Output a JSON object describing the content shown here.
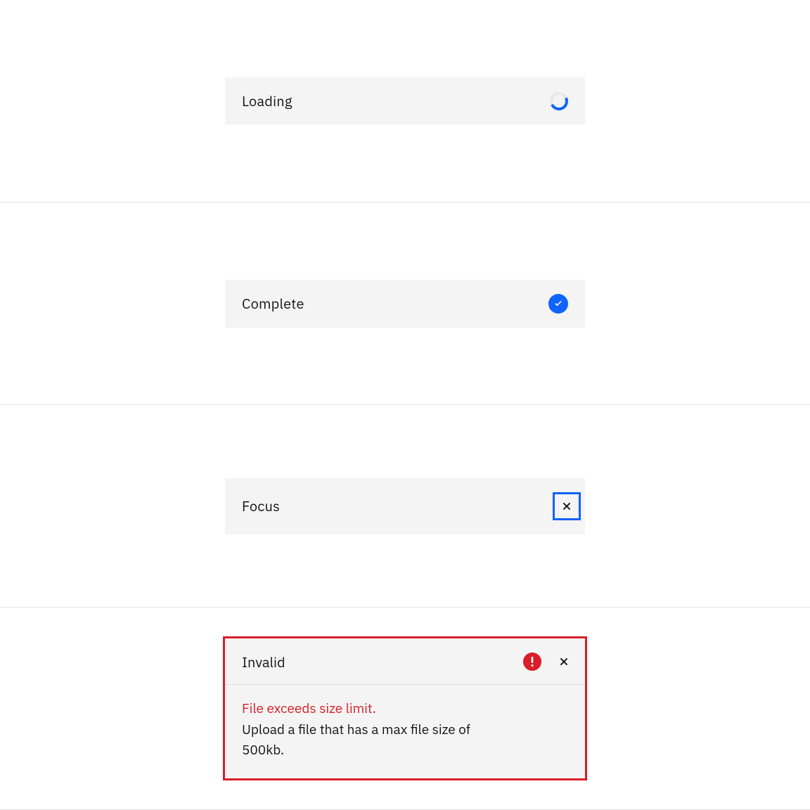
{
  "states": {
    "loading": {
      "label": "Loading"
    },
    "complete": {
      "label": "Complete"
    },
    "focus": {
      "label": "Focus"
    },
    "invalid": {
      "label": "Invalid",
      "error_title": "File exceeds size limit.",
      "error_message": "Upload a file that has a max file size of 500kb."
    }
  },
  "icons": {
    "spinner": "loading-spinner-icon",
    "check": "checkmark-filled-icon",
    "close": "close-icon",
    "error": "error-filled-icon"
  },
  "colors": {
    "accent": "#0f62fe",
    "danger": "#da1e28",
    "field": "#f4f4f4",
    "text": "#161616",
    "border": "#e0e0e0"
  }
}
